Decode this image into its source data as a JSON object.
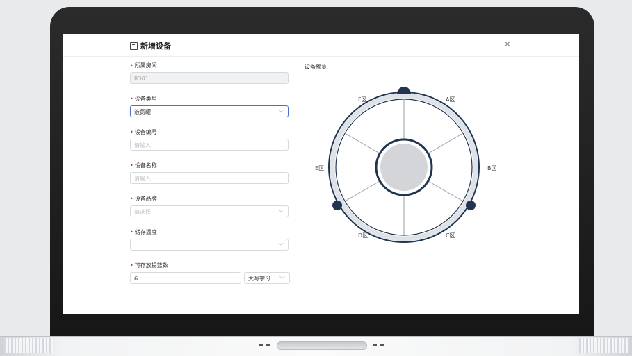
{
  "dialog": {
    "title": "新增设备",
    "close": "×"
  },
  "form": {
    "room": {
      "label": "所属房间",
      "value": "R301"
    },
    "device_type": {
      "label": "设备类型",
      "value": "液氮罐"
    },
    "device_number": {
      "label": "设备编号",
      "placeholder": "请输入"
    },
    "device_name": {
      "label": "设备名称",
      "placeholder": "请输入"
    },
    "device_brand": {
      "label": "设备品牌",
      "placeholder": "请选择"
    },
    "storage_temp": {
      "label": "储存温度",
      "value": ""
    },
    "basket_count": {
      "label": "可存放提篮数",
      "value": "6",
      "naming": "大写字母"
    }
  },
  "preview": {
    "title": "设备预览",
    "zones": [
      "A区",
      "B区",
      "C区",
      "D区",
      "E区",
      "F区"
    ]
  },
  "colors": {
    "ring_outer": "#1f3550",
    "ring_fill": "#e6e8ec",
    "hub_fill": "#d3d5d9",
    "required": "#e02020",
    "focus": "#4a6fd0"
  }
}
